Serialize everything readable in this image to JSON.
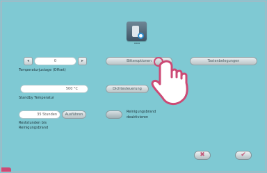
{
  "header": {
    "icon_caption": "•••"
  },
  "offset": {
    "value": "0",
    "label": "Temperaturjustage (Offset)"
  },
  "standby": {
    "value": "500 °C",
    "label": "Standby Temperatur"
  },
  "remaining": {
    "value": "35 Stunden",
    "reset_label": "Ausführen",
    "label_line1": "Reststunden bis",
    "label_line2": "Reinigungsbrand"
  },
  "buttons": {
    "left": "Bitteroptionen",
    "right": "Tastenbelegungen",
    "middle": "Dichtesteuerung"
  },
  "toggle": {
    "label_line1": "Reinigungsbrand",
    "label_line2": "deaktivieren"
  },
  "actions": {
    "cancel": "✖",
    "confirm": "✔"
  },
  "colors": {
    "background": "#7fc9d3",
    "accent_pink": "#cc4a75"
  }
}
